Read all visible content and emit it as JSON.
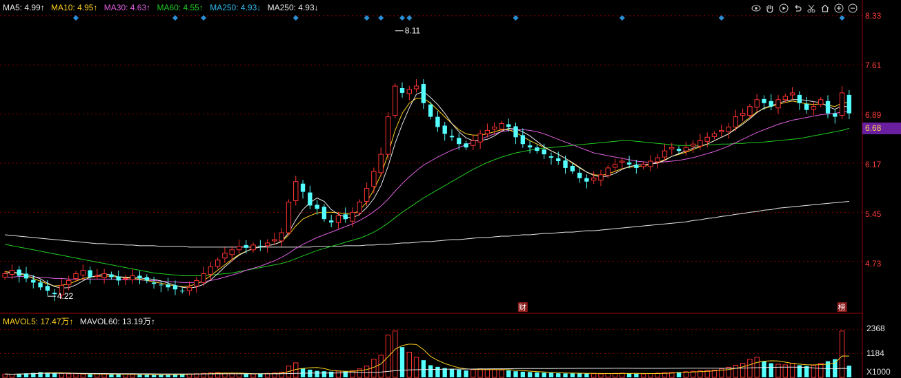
{
  "legend": {
    "ma5": "MA5: 4.99↑",
    "ma10": "MA10: 4.95↑",
    "ma30": "MA30: 4.63↑",
    "ma60": "MA60: 4.55↑",
    "ma250": "MA250: 4.93↓",
    "ma250b": "MA250: 4.93↓"
  },
  "vol_legend": {
    "mavol5": "MAVOL5: 17.47万↑",
    "mavol60": "MAVOL60: 13.19万↑"
  },
  "toolbar": {
    "icons": [
      "eye-icon",
      "hand-icon",
      "play-icon",
      "undo-icon",
      "scissors-icon",
      "home-icon",
      "zoom-in-icon",
      "zoom-out-icon"
    ]
  },
  "price_axis": [
    "8.33",
    "7.61",
    "6.89",
    "6.17",
    "5.45",
    "4.73"
  ],
  "current_price": "6.68",
  "vol_axis": [
    "2368",
    "1184",
    "X1000"
  ],
  "annotations": {
    "high": "8.11",
    "low": "4.22",
    "marker_cai": "财",
    "marker_bang": "榜"
  },
  "colors": {
    "ma5": "#e8e8e8",
    "ma10": "#ffd21f",
    "ma30": "#e060e0",
    "ma60": "#22cc22",
    "ma250": "#33bbee",
    "up": "#ff3333",
    "down": "#54ffff",
    "grid": "#8a0000",
    "axis_text": "#ff3b3b"
  },
  "chart_data": {
    "type": "candlestick",
    "ylim": [
      4.0,
      8.4
    ],
    "price_ticks": [
      8.33,
      7.61,
      6.89,
      6.17,
      5.45,
      4.73
    ],
    "volume_ticks": [
      2368,
      1184
    ],
    "volume_unit": "X1000",
    "high_label": 8.11,
    "low_label": 4.22,
    "current": 6.68,
    "close_path": [
      4.55,
      4.6,
      4.52,
      4.48,
      4.42,
      4.35,
      4.3,
      4.25,
      4.38,
      4.45,
      4.55,
      4.6,
      4.5,
      4.52,
      4.55,
      4.5,
      4.45,
      4.48,
      4.52,
      4.48,
      4.45,
      4.4,
      4.38,
      4.35,
      4.32,
      4.3,
      4.35,
      4.45,
      4.55,
      4.65,
      4.75,
      4.85,
      4.9,
      4.95,
      4.93,
      4.97,
      4.95,
      5.0,
      5.05,
      5.15,
      5.6,
      5.9,
      5.75,
      5.55,
      5.5,
      5.35,
      5.3,
      5.4,
      5.35,
      5.45,
      5.6,
      5.8,
      6.05,
      6.3,
      6.85,
      7.3,
      7.2,
      7.25,
      7.3,
      7.05,
      6.85,
      6.7,
      6.6,
      6.55,
      6.45,
      6.4,
      6.5,
      6.6,
      6.65,
      6.7,
      6.75,
      6.7,
      6.55,
      6.45,
      6.4,
      6.35,
      6.3,
      6.25,
      6.2,
      6.1,
      6.05,
      5.95,
      5.9,
      5.95,
      6.0,
      6.1,
      6.15,
      6.2,
      6.15,
      6.1,
      6.15,
      6.2,
      6.25,
      6.35,
      6.4,
      6.35,
      6.4,
      6.45,
      6.5,
      6.55,
      6.6,
      6.65,
      6.7,
      6.85,
      6.9,
      7.0,
      7.1,
      7.05,
      7.0,
      7.1,
      7.15,
      7.2,
      7.05,
      6.95,
      7.0,
      7.1,
      6.9,
      6.85,
      7.2,
      6.9
    ],
    "ma10_path": [
      4.58,
      4.57,
      4.55,
      4.52,
      4.48,
      4.44,
      4.4,
      4.37,
      4.38,
      4.4,
      4.44,
      4.48,
      4.5,
      4.51,
      4.52,
      4.51,
      4.5,
      4.49,
      4.48,
      4.47,
      4.45,
      4.43,
      4.41,
      4.39,
      4.37,
      4.36,
      4.37,
      4.4,
      4.45,
      4.52,
      4.6,
      4.68,
      4.76,
      4.83,
      4.88,
      4.92,
      4.94,
      4.96,
      4.98,
      5.02,
      5.12,
      5.25,
      5.35,
      5.4,
      5.44,
      5.45,
      5.45,
      5.44,
      5.43,
      5.42,
      5.48,
      5.6,
      5.78,
      6.0,
      6.3,
      6.65,
      6.9,
      7.05,
      7.12,
      7.12,
      7.05,
      6.95,
      6.85,
      6.75,
      6.66,
      6.6,
      6.58,
      6.58,
      6.6,
      6.63,
      6.66,
      6.66,
      6.62,
      6.56,
      6.5,
      6.45,
      6.4,
      6.35,
      6.3,
      6.24,
      6.17,
      6.1,
      6.04,
      6.0,
      5.99,
      6.01,
      6.05,
      6.09,
      6.11,
      6.12,
      6.13,
      6.15,
      6.18,
      6.22,
      6.27,
      6.3,
      6.33,
      6.37,
      6.41,
      6.45,
      6.5,
      6.55,
      6.6,
      6.68,
      6.76,
      6.84,
      6.92,
      6.97,
      7.0,
      7.03,
      7.06,
      7.08,
      7.06,
      7.04,
      7.03,
      7.04,
      7.02,
      7.0,
      7.05,
      7.06
    ],
    "ma30_path": [
      4.5,
      4.5,
      4.51,
      4.51,
      4.5,
      4.5,
      4.49,
      4.48,
      4.48,
      4.47,
      4.47,
      4.47,
      4.47,
      4.47,
      4.47,
      4.47,
      4.47,
      4.46,
      4.46,
      4.46,
      4.45,
      4.45,
      4.44,
      4.43,
      4.43,
      4.42,
      4.42,
      4.42,
      4.43,
      4.45,
      4.47,
      4.5,
      4.53,
      4.56,
      4.6,
      4.63,
      4.66,
      4.7,
      4.74,
      4.79,
      4.85,
      4.92,
      4.98,
      5.03,
      5.08,
      5.12,
      5.16,
      5.2,
      5.24,
      5.28,
      5.33,
      5.39,
      5.46,
      5.54,
      5.64,
      5.76,
      5.87,
      5.97,
      6.06,
      6.14,
      6.2,
      6.26,
      6.31,
      6.36,
      6.4,
      6.44,
      6.48,
      6.52,
      6.56,
      6.6,
      6.63,
      6.65,
      6.66,
      6.66,
      6.65,
      6.63,
      6.6,
      6.56,
      6.52,
      6.48,
      6.44,
      6.4,
      6.36,
      6.32,
      6.3,
      6.28,
      6.26,
      6.24,
      6.22,
      6.2,
      6.19,
      6.18,
      6.18,
      6.19,
      6.2,
      6.21,
      6.23,
      6.25,
      6.28,
      6.31,
      6.34,
      6.38,
      6.42,
      6.47,
      6.52,
      6.57,
      6.62,
      6.66,
      6.7,
      6.74,
      6.77,
      6.8,
      6.82,
      6.84,
      6.86,
      6.88,
      6.89,
      6.9,
      6.92,
      6.93
    ],
    "ma60_path": [
      4.98,
      4.96,
      4.94,
      4.92,
      4.9,
      4.88,
      4.86,
      4.84,
      4.82,
      4.8,
      4.78,
      4.76,
      4.74,
      4.72,
      4.7,
      4.68,
      4.66,
      4.64,
      4.62,
      4.6,
      4.58,
      4.56,
      4.55,
      4.54,
      4.53,
      4.52,
      4.52,
      4.52,
      4.52,
      4.53,
      4.54,
      4.55,
      4.56,
      4.58,
      4.6,
      4.62,
      4.64,
      4.66,
      4.68,
      4.7,
      4.73,
      4.77,
      4.81,
      4.85,
      4.89,
      4.92,
      4.95,
      4.98,
      5.01,
      5.04,
      5.07,
      5.11,
      5.16,
      5.22,
      5.29,
      5.37,
      5.45,
      5.52,
      5.59,
      5.66,
      5.72,
      5.78,
      5.84,
      5.9,
      5.96,
      6.02,
      6.08,
      6.13,
      6.18,
      6.22,
      6.26,
      6.29,
      6.32,
      6.34,
      6.36,
      6.38,
      6.39,
      6.4,
      6.41,
      6.42,
      6.43,
      6.44,
      6.45,
      6.46,
      6.47,
      6.48,
      6.49,
      6.5,
      6.5,
      6.49,
      6.48,
      6.47,
      6.46,
      6.45,
      6.44,
      6.43,
      6.43,
      6.43,
      6.43,
      6.44,
      6.44,
      6.45,
      6.45,
      6.46,
      6.46,
      6.47,
      6.47,
      6.48,
      6.49,
      6.5,
      6.51,
      6.52,
      6.53,
      6.55,
      6.57,
      6.59,
      6.61,
      6.63,
      6.65,
      6.68
    ],
    "ma250_path": [
      5.12,
      5.11,
      5.1,
      5.09,
      5.08,
      5.07,
      5.06,
      5.05,
      5.04,
      5.03,
      5.02,
      5.01,
      5.0,
      4.99,
      4.99,
      4.98,
      4.98,
      4.97,
      4.97,
      4.96,
      4.96,
      4.96,
      4.95,
      4.95,
      4.95,
      4.95,
      4.94,
      4.94,
      4.94,
      4.94,
      4.94,
      4.94,
      4.94,
      4.94,
      4.94,
      4.94,
      4.94,
      4.94,
      4.94,
      4.94,
      4.94,
      4.94,
      4.94,
      4.94,
      4.95,
      4.95,
      4.95,
      4.95,
      4.96,
      4.96,
      4.96,
      4.97,
      4.97,
      4.98,
      4.98,
      4.99,
      5.0,
      5.0,
      5.01,
      5.02,
      5.02,
      5.03,
      5.04,
      5.05,
      5.05,
      5.06,
      5.07,
      5.08,
      5.08,
      5.09,
      5.1,
      5.1,
      5.11,
      5.12,
      5.12,
      5.13,
      5.14,
      5.14,
      5.15,
      5.16,
      5.16,
      5.17,
      5.18,
      5.18,
      5.19,
      5.2,
      5.21,
      5.22,
      5.23,
      5.24,
      5.25,
      5.26,
      5.27,
      5.28,
      5.29,
      5.3,
      5.31,
      5.33,
      5.34,
      5.36,
      5.37,
      5.39,
      5.4,
      5.42,
      5.43,
      5.45,
      5.46,
      5.48,
      5.49,
      5.51,
      5.52,
      5.53,
      5.54,
      5.55,
      5.56,
      5.57,
      5.58,
      5.59,
      5.6,
      5.61
    ],
    "volume": [
      160,
      150,
      180,
      200,
      220,
      260,
      240,
      210,
      190,
      170,
      180,
      160,
      150,
      170,
      160,
      140,
      150,
      160,
      140,
      130,
      120,
      110,
      130,
      140,
      150,
      160,
      170,
      180,
      200,
      220,
      240,
      210,
      190,
      180,
      170,
      160,
      190,
      200,
      220,
      260,
      560,
      720,
      450,
      380,
      320,
      300,
      280,
      310,
      290,
      330,
      420,
      560,
      900,
      1100,
      2100,
      2300,
      1500,
      1250,
      1000,
      850,
      600,
      520,
      460,
      420,
      380,
      340,
      380,
      420,
      400,
      380,
      360,
      340,
      300,
      280,
      260,
      240,
      230,
      220,
      200,
      190,
      200,
      210,
      190,
      180,
      170,
      190,
      200,
      210,
      190,
      180,
      170,
      190,
      210,
      230,
      250,
      260,
      280,
      300,
      320,
      340,
      360,
      420,
      500,
      600,
      700,
      900,
      1000,
      800,
      700,
      650,
      620,
      700,
      600,
      560,
      600,
      700,
      800,
      900,
      2300,
      580
    ],
    "markers": [
      {
        "label": "财",
        "index": 73
      },
      {
        "label": "榜",
        "index": 118
      }
    ]
  }
}
